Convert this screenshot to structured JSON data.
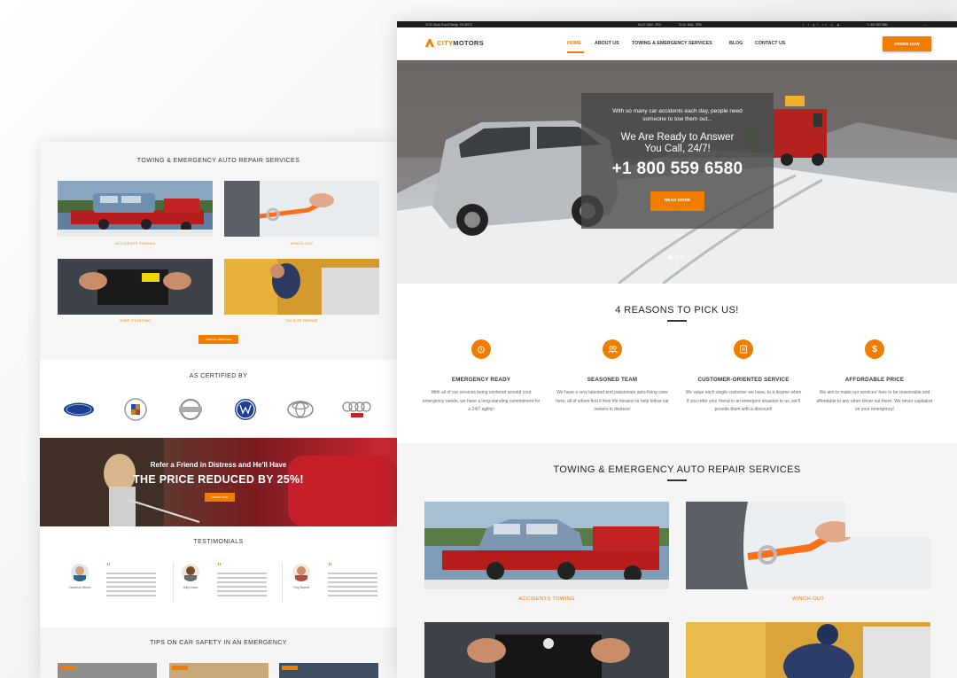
{
  "topbar": {
    "address": "22 St. Black Road Raleigh, PA 54578",
    "hours_weekdays": "Mo-Fr: 8AM - 9PM",
    "hours_weekend": "St-Sn: 8AM - 9PM",
    "phone": "+1 800 559 6580"
  },
  "brand": {
    "part1": "CITY",
    "part2": "MOTORS"
  },
  "nav": {
    "items": [
      "HOME",
      "ABOUT US",
      "TOWING & EMERGENCY SERVICES",
      "BLOG",
      "CONTACT US"
    ],
    "order_button": "ORDER NOW"
  },
  "hero": {
    "intro": "With so many car accidents each day, people need someone to tow them out...",
    "headline": "We Are Ready to Answer You Call, 24/7!",
    "phone": "+1 800 559 6580",
    "button": "READ MORE"
  },
  "reasons": {
    "title": "4 REASONS TO PICK US!",
    "items": [
      {
        "title": "EMERGENCY READY",
        "text": "With all of our services being centered around your emergency needs, we have a long-standing commitment for a 24/7 agility!",
        "icon": "alarm-icon"
      },
      {
        "title": "SEASONED TEAM",
        "text": "We have a very talented and passionate auto-fixing crew here, all of whom find it their life mission to help fellow car owners in distress!",
        "icon": "team-icon"
      },
      {
        "title": "CUSTOMER-ORIENTED SERVICE",
        "text": "We value each single customer we have, to a degree when if you refer your friend in an emergent situation to us, we'll provide them with a discount!",
        "icon": "clipboard-icon"
      },
      {
        "title": "AFFORDABLE PRICE",
        "text": "We aim to make our services' fees to be reasonable and affordable to any other driver out there. We never capitalize on your emergency!",
        "icon": "dollar-icon"
      }
    ]
  },
  "services": {
    "title": "TOWING & EMERGENCY AUTO REPAIR SERVICES",
    "items": [
      "ACCIDENTS TOWING",
      "WINCH-OUT"
    ]
  },
  "back_page": {
    "services_title": "TOWING & EMERGENCY AUTO REPAIR SERVICES",
    "services": [
      "ACCIDENTS TOWING",
      "WINCH-OUT",
      "JUMP STARTING",
      "ON-SITE REPAIR"
    ],
    "view_all": "VIEW ALL SERVICES",
    "certified_title": "AS CERTIFIED BY",
    "promo_line1": "Refer a Friend in Distress and He'll Have",
    "promo_line2": "THE PRICE REDUCED BY 25%!",
    "promo_button": "ORDER NOW",
    "testimonials_title": "TESTIMONIALS",
    "testimonials": [
      "Cameron Welsh",
      "Gary Dean",
      "Troy Barrett"
    ],
    "tips_title": "TIPS ON CAR SAFETY IN AN EMERGENCY"
  },
  "colors": {
    "accent": "#f07d00",
    "dark": "#1c1c1c"
  }
}
